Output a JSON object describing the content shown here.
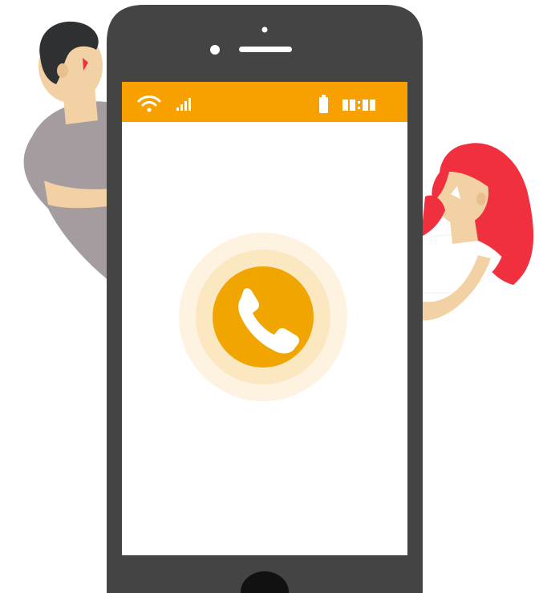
{
  "status_bar": {
    "time": "",
    "wifi_icon": "wifi-icon",
    "signal_icon": "signal-icon",
    "battery_icon": "battery-icon",
    "clock_icon": "clock-digits-icon"
  },
  "call": {
    "icon": "phone-icon",
    "aria_label": "Call"
  },
  "colors": {
    "phone_body": "#444444",
    "screen": "#ffffff",
    "status_bar": "#f7a000",
    "call_button": "#f0a500",
    "call_glow_inner": "#fbe7c0",
    "call_glow_outer": "#fdf3e0",
    "skin": "#f2d2a4",
    "skin_shade": "#e8c08d",
    "man_hair": "#2f3032",
    "man_shirt": "#a49c9e",
    "woman_hair": "#f0303f",
    "woman_shirt": "#ffffff"
  }
}
